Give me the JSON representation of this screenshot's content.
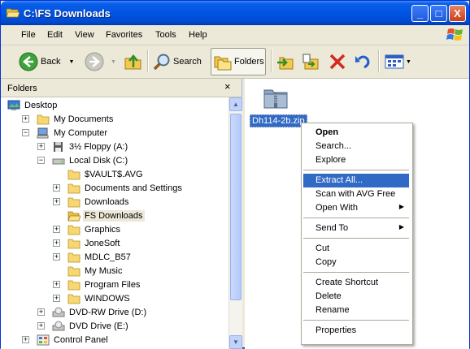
{
  "window": {
    "title": "C:\\FS Downloads",
    "buttons": {
      "minimize": "_",
      "maximize": "□",
      "close": "X"
    }
  },
  "menu": [
    "File",
    "Edit",
    "View",
    "Favorites",
    "Tools",
    "Help"
  ],
  "toolbar": {
    "back": "Back",
    "search": "Search",
    "folders": "Folders"
  },
  "folders_pane": {
    "title": "Folders",
    "close": "×",
    "tree": [
      {
        "label": "Desktop",
        "icon": "desktop-icon",
        "expander": ""
      },
      {
        "label": "My Documents",
        "icon": "folder-icon",
        "expander": "+"
      },
      {
        "label": "My Computer",
        "icon": "computer-icon",
        "expander": "−"
      },
      {
        "label": "3½ Floppy (A:)",
        "icon": "floppy-icon",
        "expander": "+"
      },
      {
        "label": "Local Disk (C:)",
        "icon": "disk-icon",
        "expander": "−"
      },
      {
        "label": "$VAULT$.AVG",
        "icon": "folder-icon",
        "expander": ""
      },
      {
        "label": "Documents and Settings",
        "icon": "folder-icon",
        "expander": "+"
      },
      {
        "label": "Downloads",
        "icon": "folder-icon",
        "expander": "+"
      },
      {
        "label": "FS Downloads",
        "icon": "open-folder-icon",
        "expander": "",
        "selected": true
      },
      {
        "label": "Graphics",
        "icon": "folder-icon",
        "expander": "+"
      },
      {
        "label": "JoneSoft",
        "icon": "folder-icon",
        "expander": "+"
      },
      {
        "label": "MDLC_B57",
        "icon": "folder-icon",
        "expander": "+"
      },
      {
        "label": "My Music",
        "icon": "folder-icon",
        "expander": ""
      },
      {
        "label": "Program Files",
        "icon": "folder-icon",
        "expander": "+"
      },
      {
        "label": "WINDOWS",
        "icon": "folder-icon",
        "expander": "+"
      },
      {
        "label": "DVD-RW Drive (D:)",
        "icon": "dvd-icon",
        "expander": "+"
      },
      {
        "label": "DVD Drive (E:)",
        "icon": "dvd-icon",
        "expander": "+"
      },
      {
        "label": "Control Panel",
        "icon": "control-panel-icon",
        "expander": "+"
      }
    ]
  },
  "file": {
    "name": "Dh114-2b.zip",
    "icon": "zip-folder-icon"
  },
  "context_menu": {
    "groups": [
      [
        {
          "label": "Open",
          "bold": true
        },
        {
          "label": "Search..."
        },
        {
          "label": "Explore"
        }
      ],
      [
        {
          "label": "Extract All...",
          "highlighted": true
        },
        {
          "label": "Scan with AVG Free"
        },
        {
          "label": "Open With",
          "submenu": true
        }
      ],
      [
        {
          "label": "Send To",
          "submenu": true
        }
      ],
      [
        {
          "label": "Cut"
        },
        {
          "label": "Copy"
        }
      ],
      [
        {
          "label": "Create Shortcut"
        },
        {
          "label": "Delete"
        },
        {
          "label": "Rename"
        }
      ],
      [
        {
          "label": "Properties"
        }
      ]
    ]
  },
  "colors": {
    "titlebar": "#0054e3",
    "selection": "#316ac5",
    "chrome": "#ece9d8",
    "folder": "#f7d774"
  }
}
